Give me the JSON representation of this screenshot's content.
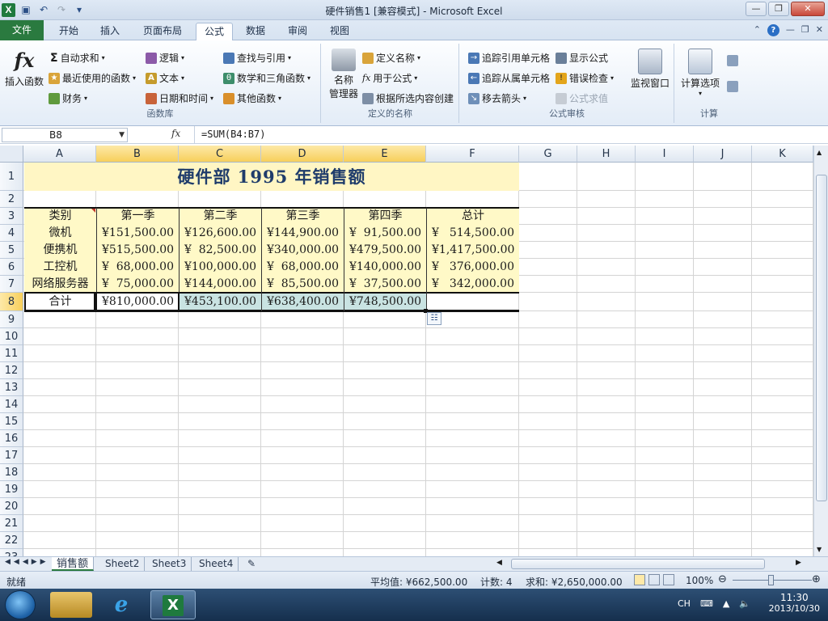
{
  "window": {
    "title": "硬件销售1  [兼容模式]  -  Microsoft Excel"
  },
  "tabs": [
    "文件",
    "开始",
    "插入",
    "页面布局",
    "公式",
    "数据",
    "审阅",
    "视图"
  ],
  "ribbon": {
    "insert_function": "插入函数",
    "autosum": "自动求和",
    "recent": "最近使用的函数",
    "financial": "财务",
    "logical": "逻辑",
    "text": "文本",
    "datetime": "日期和时间",
    "lookup": "查找与引用",
    "math": "数学和三角函数",
    "more": "其他函数",
    "group_library": "函数库",
    "name_manager_1": "名称",
    "name_manager_2": "管理器",
    "define_name": "定义名称",
    "use_in_formula": "用于公式",
    "create_from_sel": "根据所选内容创建",
    "group_names": "定义的名称",
    "trace_precedents": "追踪引用单元格",
    "trace_dependents": "追踪从属单元格",
    "remove_arrows": "移去箭头",
    "show_formulas": "显示公式",
    "error_checking": "错误检查",
    "evaluate_formula": "公式求值",
    "watch_window": "监视窗口",
    "group_auditing": "公式审核",
    "calc_options": "计算选项",
    "group_calc": "计算"
  },
  "formula_bar": {
    "name_box": "B8",
    "fx": "fx",
    "formula": "=SUM(B4:B7)"
  },
  "columns": [
    "A",
    "B",
    "C",
    "D",
    "E",
    "F",
    "G",
    "H",
    "I",
    "J",
    "K"
  ],
  "rows": [
    "1",
    "2",
    "3",
    "4",
    "5",
    "6",
    "7",
    "8",
    "9",
    "10",
    "11",
    "12",
    "13",
    "14",
    "15",
    "16",
    "17",
    "18",
    "19",
    "20",
    "21",
    "22",
    "23"
  ],
  "sheet": {
    "title": "硬件部  1995  年销售额",
    "headers": [
      "类别",
      "第一季",
      "第二季",
      "第三季",
      "第四季",
      "总计"
    ],
    "currency": "¥",
    "data": [
      [
        "微机",
        "151,500.00",
        "126,600.00",
        "144,900.00",
        "91,500.00",
        "514,500.00"
      ],
      [
        "便携机",
        "515,500.00",
        "82,500.00",
        "340,000.00",
        "479,500.00",
        "1,417,500.00"
      ],
      [
        "工控机",
        "68,000.00",
        "100,000.00",
        "68,000.00",
        "140,000.00",
        "376,000.00"
      ],
      [
        "网络服务器",
        "75,000.00",
        "144,000.00",
        "85,500.00",
        "37,500.00",
        "342,000.00"
      ]
    ],
    "total_row": [
      "合计",
      "810,000.00",
      "453,100.00",
      "638,400.00",
      "748,500.00",
      ""
    ]
  },
  "sheet_tabs": [
    "销售额",
    "Sheet2",
    "Sheet3",
    "Sheet4"
  ],
  "status": {
    "ready": "就绪",
    "average": "平均值: ¥662,500.00",
    "count": "计数: 4",
    "sum": "求和: ¥2,650,000.00",
    "zoom": "100%"
  },
  "taskbar": {
    "lang": "CH",
    "time": "11:30",
    "date": "2013/10/30"
  }
}
